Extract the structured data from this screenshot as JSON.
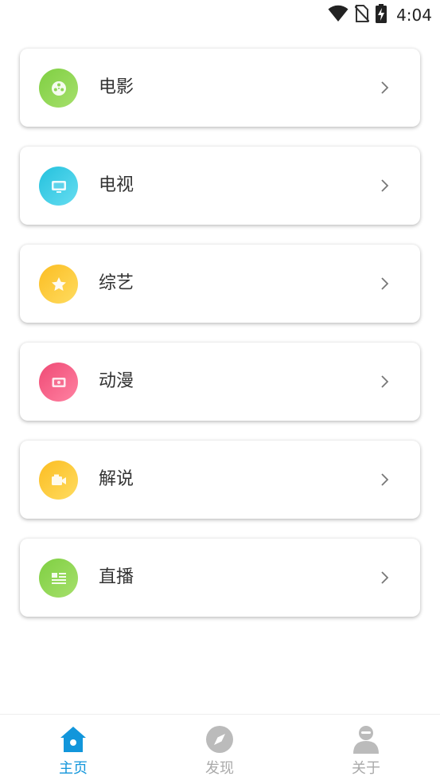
{
  "status_bar": {
    "time": "4:04",
    "icons": [
      "wifi-icon",
      "no-sim-icon",
      "battery-charging-icon"
    ]
  },
  "categories": [
    {
      "label": "电影",
      "icon": "film-reel-icon",
      "gradient": [
        "#86d34a",
        "#a4df69"
      ]
    },
    {
      "label": "电视",
      "icon": "tv-icon",
      "gradient": [
        "#2ec7e0",
        "#5fdbef"
      ]
    },
    {
      "label": "综艺",
      "icon": "star-icon",
      "gradient": [
        "#fbc02d",
        "#ffdb5c"
      ]
    },
    {
      "label": "动漫",
      "icon": "anime-icon",
      "gradient": [
        "#f2567e",
        "#ff7d9d"
      ]
    },
    {
      "label": "解说",
      "icon": "video-camera-icon",
      "gradient": [
        "#fbc02d",
        "#ffdb5c"
      ]
    },
    {
      "label": "直播",
      "icon": "live-list-icon",
      "gradient": [
        "#86d34a",
        "#a4df69"
      ]
    }
  ],
  "bottom_nav": {
    "items": [
      {
        "label": "主页",
        "icon": "home-icon",
        "active": true
      },
      {
        "label": "发现",
        "icon": "compass-icon",
        "active": false
      },
      {
        "label": "关于",
        "icon": "user-icon",
        "active": false
      }
    ],
    "active_color": "#1296db",
    "inactive_color": "#aaaaaa"
  }
}
